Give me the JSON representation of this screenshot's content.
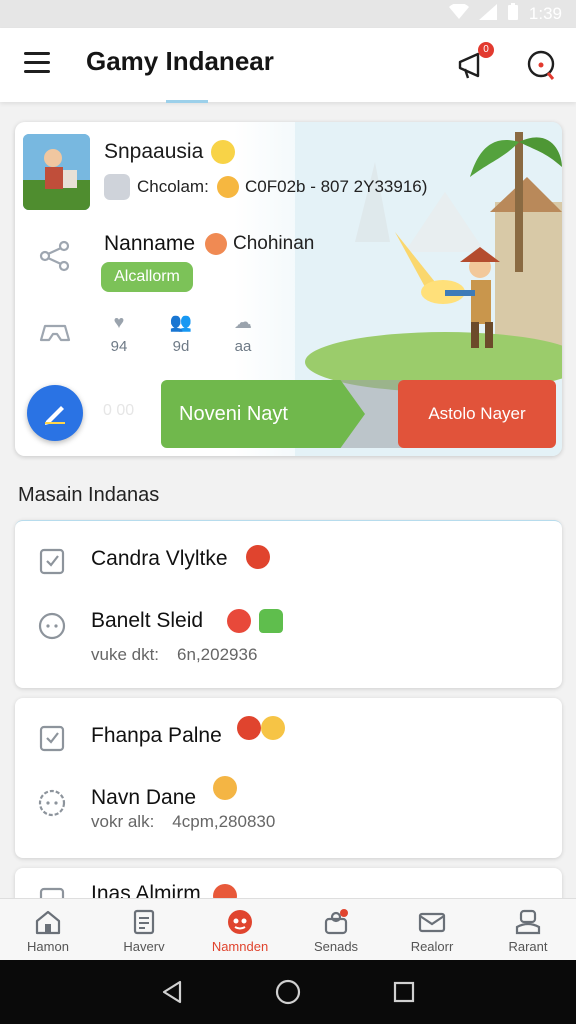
{
  "status_bar": {
    "time": "1:39"
  },
  "app_bar": {
    "title": "Gamy Indanear",
    "notification_count": "0"
  },
  "hero": {
    "game_name": "Snpaausia",
    "channel": "Chcolam:",
    "code": "C0F02b - 807 2Y33916)",
    "player_name": "Nanname",
    "player_role": "Chohinan",
    "status_label": "Alcallorm",
    "stats": [
      {
        "icon": "heart-icon",
        "value": "94"
      },
      {
        "icon": "people-icon",
        "value": "9d"
      },
      {
        "icon": "cloud-icon",
        "value": "aa"
      }
    ],
    "progress_label": "0 00",
    "primary_action": "Noveni Nayt",
    "secondary_action": "Astolo Nayer"
  },
  "section": {
    "title": "Masain Indanas"
  },
  "cards": [
    {
      "title": "Candra Vlyltke",
      "subtitle": "Banelt Sleid",
      "meta_label": "vuke dkt:",
      "meta_value": "6n,202936"
    },
    {
      "title": "Fhanpa Palne",
      "subtitle": "Navn Dane",
      "meta_label": "vokr alk:",
      "meta_value": "4cpm,280830"
    },
    {
      "title": "Inas Almirm"
    }
  ],
  "bottom_nav": [
    {
      "label": "Hamon",
      "icon": "home-icon",
      "active": false
    },
    {
      "label": "Haverv",
      "icon": "document-icon",
      "active": false
    },
    {
      "label": "Namnden",
      "icon": "game-icon",
      "active": true
    },
    {
      "label": "Senads",
      "icon": "friends-icon",
      "active": false
    },
    {
      "label": "Realorr",
      "icon": "mail-icon",
      "active": false
    },
    {
      "label": "Rarant",
      "icon": "profile-icon",
      "active": false
    }
  ],
  "colors": {
    "primary": "#2a73e4",
    "accent": "#e0442e",
    "green": "#70b84c",
    "red": "#e1533a"
  }
}
